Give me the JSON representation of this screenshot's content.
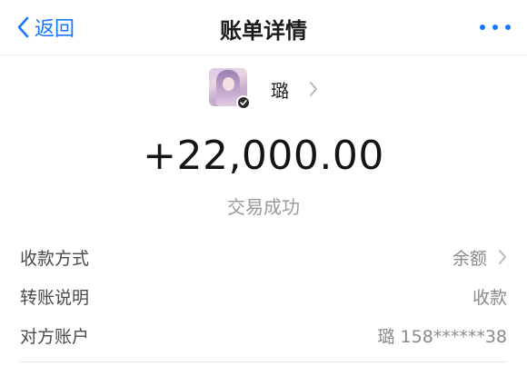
{
  "nav": {
    "back_label": "返回",
    "title": "账单详情",
    "back_icon": "chevron-left-icon",
    "more_icon": "more-dots-icon"
  },
  "payee": {
    "name": "璐",
    "avatar_badge_icon": "verified-badge-icon"
  },
  "transaction": {
    "amount": "+22,000.00",
    "status": "交易成功"
  },
  "details": [
    {
      "label": "收款方式",
      "value": "余额"
    },
    {
      "label": "转账说明",
      "value": "收款"
    },
    {
      "label": "对方账户",
      "value": "璐 158******38"
    }
  ],
  "colors": {
    "accent": "#1677ff",
    "muted": "#9a9a9a"
  }
}
